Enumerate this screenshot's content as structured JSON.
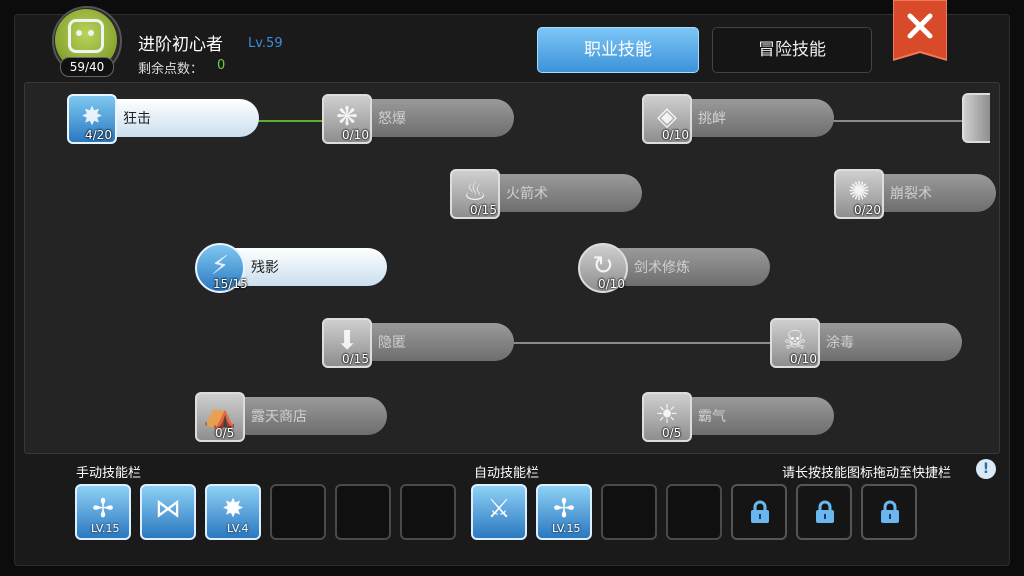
{
  "player": {
    "avatar_icon": "hero-avatar-icon",
    "skill_points_badge": "59/40",
    "name": "进阶初心者",
    "level": "Lv.59",
    "remaining_label": "剩余点数：",
    "remaining_value": "0"
  },
  "tabs": [
    {
      "label": "职业技能",
      "active": true
    },
    {
      "label": "冒险技能",
      "active": false
    }
  ],
  "skills": [
    {
      "name": "狂击",
      "level": "4/20",
      "active": true
    },
    {
      "name": "怒爆",
      "level": "0/10",
      "active": false
    },
    {
      "name": "挑衅",
      "level": "0/10",
      "active": false
    },
    {
      "name": "火箭术",
      "level": "0/15",
      "active": false
    },
    {
      "name": "崩裂术",
      "level": "0/20",
      "active": false
    },
    {
      "name": "残影",
      "level": "15/15",
      "active": true
    },
    {
      "name": "剑术修炼",
      "level": "0/10",
      "active": false
    },
    {
      "name": "隐匿",
      "level": "0/15",
      "active": false
    },
    {
      "name": "涂毒",
      "level": "0/10",
      "active": false
    },
    {
      "name": "露天商店",
      "level": "0/5",
      "active": false
    },
    {
      "name": "霸气",
      "level": "0/5",
      "active": false
    }
  ],
  "bottom": {
    "manual_label": "手动技能栏",
    "auto_label": "自动技能栏",
    "hint": "请长按技能图标拖动至快捷栏",
    "hint_icon": "!",
    "manual_slots": [
      {
        "icon": "shield-cross-icon",
        "level": "LV.15"
      },
      {
        "icon": "ribbon-icon",
        "level": ""
      },
      {
        "icon": "burst-icon",
        "level": "LV.4"
      },
      {
        "icon": "",
        "level": ""
      },
      {
        "icon": "",
        "level": ""
      },
      {
        "icon": "",
        "level": ""
      }
    ],
    "auto_slots": [
      {
        "icon": "sword-icon",
        "level": ""
      },
      {
        "icon": "shield-cross-icon",
        "level": "LV.15"
      },
      {
        "icon": "",
        "level": ""
      },
      {
        "icon": "",
        "level": ""
      },
      {
        "icon": "lock-icon",
        "level": ""
      },
      {
        "icon": "lock-icon",
        "level": ""
      },
      {
        "icon": "lock-icon",
        "level": ""
      }
    ]
  },
  "colors": {
    "accent": "#3d92d9",
    "points": "#6cd23f",
    "close": "#d94a2a"
  }
}
